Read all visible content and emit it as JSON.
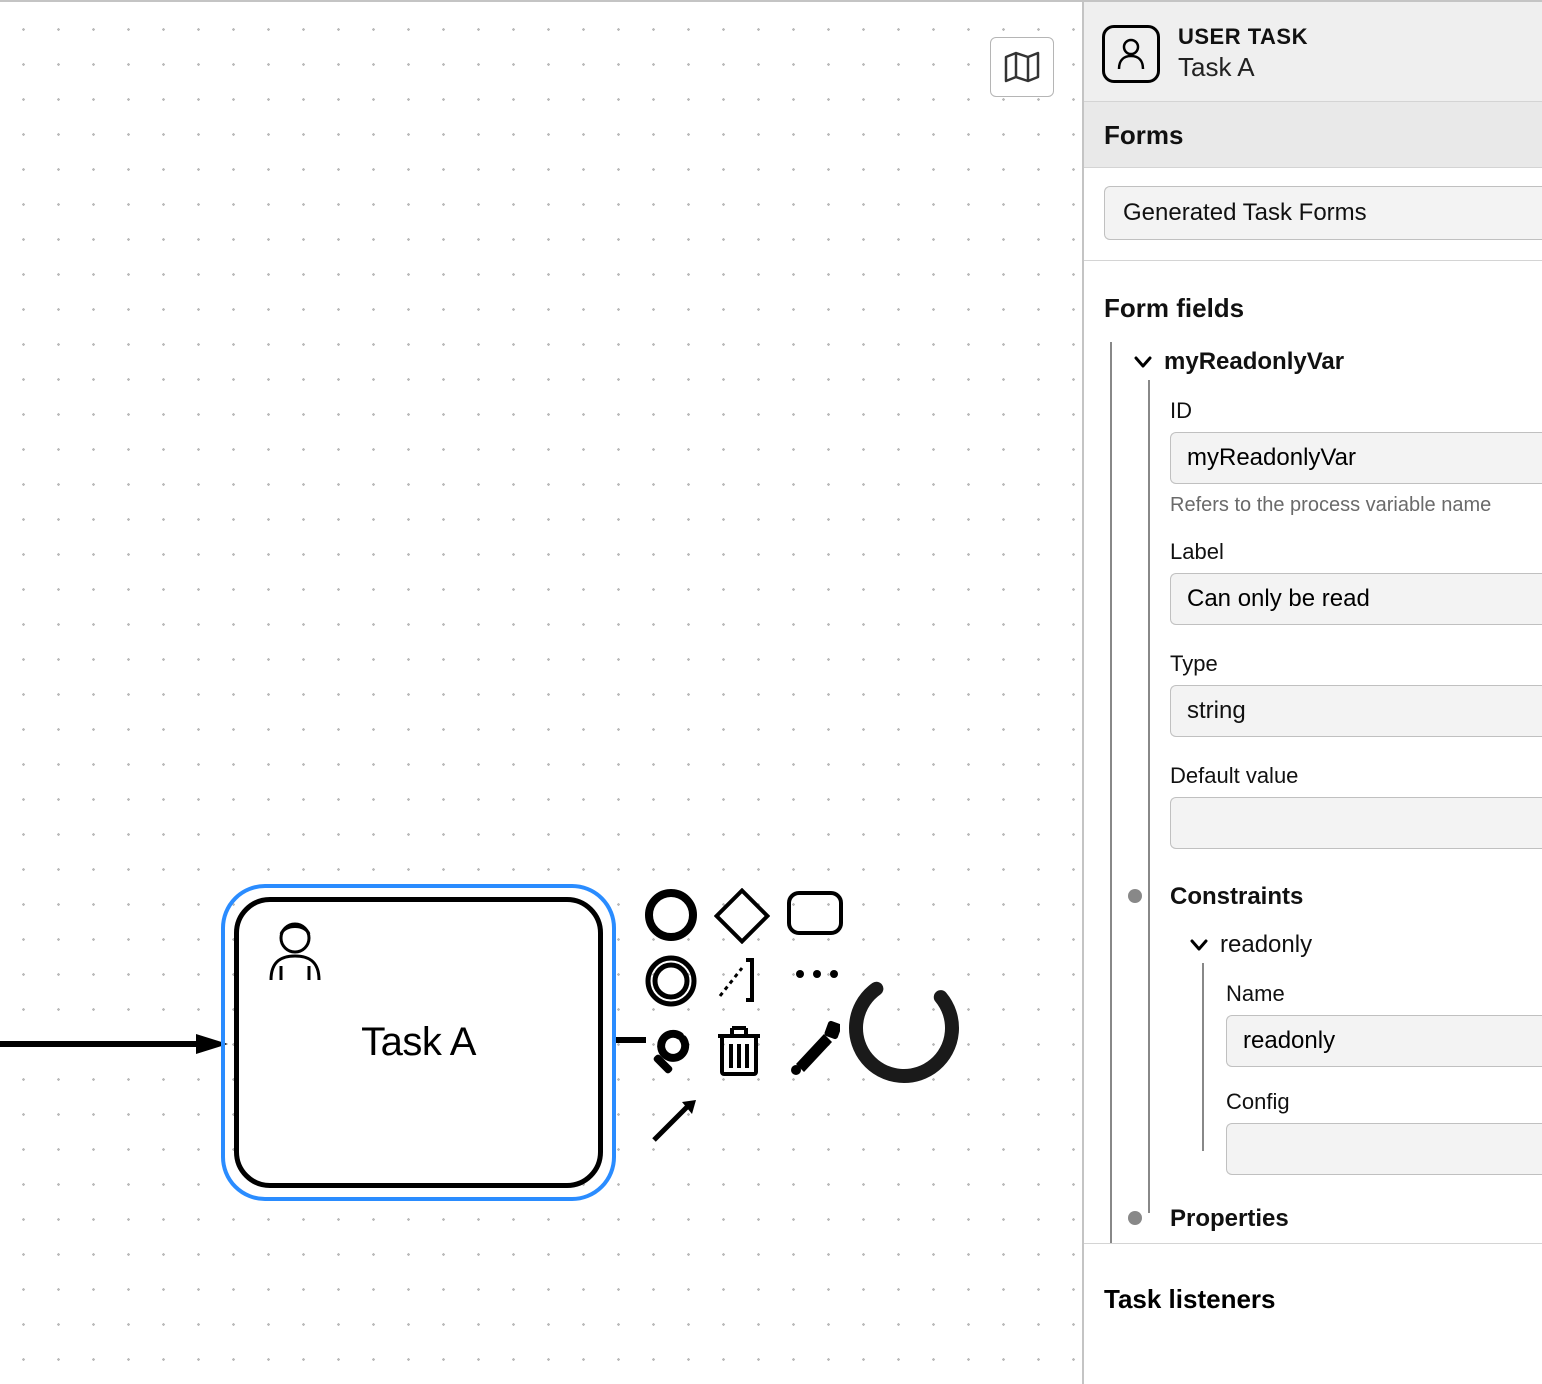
{
  "panel": {
    "type_label": "USER TASK",
    "task_name": "Task A",
    "forms_section": "Forms",
    "forms_value": "Generated Task Forms",
    "form_fields_section": "Form fields",
    "field_item_name": "myReadonlyVar",
    "id_label": "ID",
    "id_value": "myReadonlyVar",
    "id_helper": "Refers to the process variable name",
    "label_label": "Label",
    "label_value": "Can only be read",
    "type_label_field": "Type",
    "type_value": "string",
    "default_label": "Default value",
    "default_value": "",
    "constraints_label": "Constraints",
    "constraint_item_name": "readonly",
    "constraint_name_label": "Name",
    "constraint_name_value": "readonly",
    "constraint_config_label": "Config",
    "constraint_config_value": "",
    "properties_label": "Properties",
    "truncated_section": "Task listeners"
  },
  "canvas": {
    "task_label": "Task A"
  }
}
